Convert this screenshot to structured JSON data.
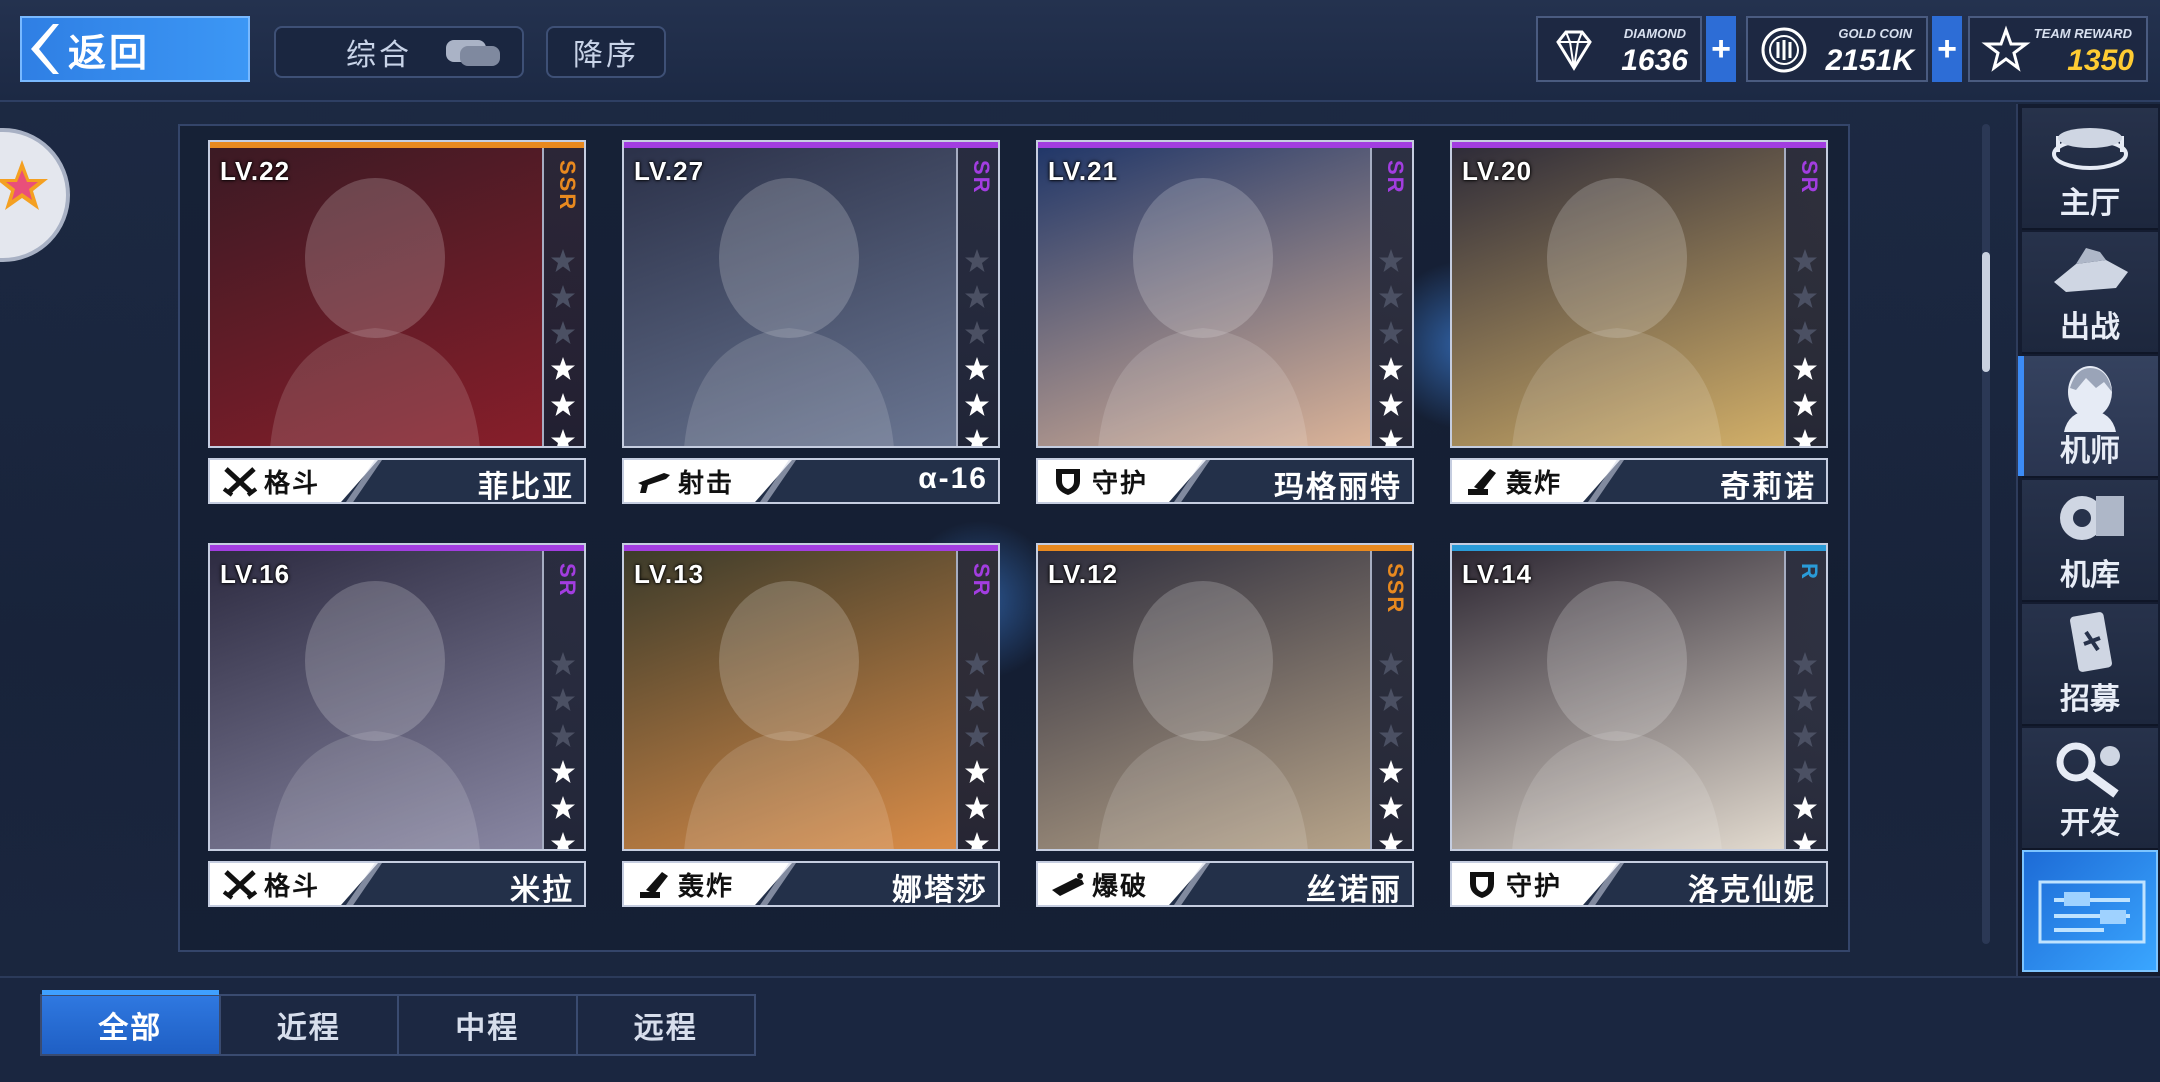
{
  "header": {
    "back_label": "返回",
    "sort_label": "综合",
    "order_label": "降序"
  },
  "resources": {
    "diamond": {
      "name": "DIAMOND",
      "value": "1636",
      "icon": "diamond-icon"
    },
    "gold": {
      "name": "GOLD COIN",
      "value": "2151K",
      "icon": "gold-coin-icon"
    },
    "team": {
      "name": "TEAM REWARD",
      "value": "1350",
      "icon": "team-reward-icon"
    },
    "plus_label": "+"
  },
  "cards": [
    {
      "lv": "LV.22",
      "rarity": "SSR",
      "stars": 3,
      "class": "格斗",
      "class_icon": "fight-icon",
      "name": "菲比亚",
      "color": "#e8891f",
      "bg": [
        "#3a1a24",
        "#8a1e2a"
      ]
    },
    {
      "lv": "LV.27",
      "rarity": "SR",
      "stars": 3,
      "class": "射击",
      "class_icon": "rifle-icon",
      "name": "α-16",
      "color": "#a23de0",
      "bg": [
        "#2a3048",
        "#6c7894"
      ]
    },
    {
      "lv": "LV.21",
      "rarity": "SR",
      "stars": 3,
      "class": "守护",
      "class_icon": "shield-icon",
      "name": "玛格丽特",
      "color": "#a23de0",
      "bg": [
        "#1e3568",
        "#e2b89a"
      ]
    },
    {
      "lv": "LV.20",
      "rarity": "SR",
      "stars": 3,
      "class": "轰炸",
      "class_icon": "mortar-icon",
      "name": "奇莉诺",
      "color": "#a23de0",
      "bg": [
        "#2c2a38",
        "#d8b46a"
      ]
    },
    {
      "lv": "LV.16",
      "rarity": "SR",
      "stars": 3,
      "class": "格斗",
      "class_icon": "fight-icon",
      "name": "米拉",
      "color": "#a23de0",
      "bg": [
        "#2c2a40",
        "#8c8aa6"
      ]
    },
    {
      "lv": "LV.13",
      "rarity": "SR",
      "stars": 3,
      "class": "轰炸",
      "class_icon": "mortar-icon",
      "name": "娜塔莎",
      "color": "#a23de0",
      "bg": [
        "#3a3a2a",
        "#e0904a"
      ]
    },
    {
      "lv": "LV.12",
      "rarity": "SSR",
      "stars": 3,
      "class": "爆破",
      "class_icon": "demolition-icon",
      "name": "丝诺丽",
      "color": "#e8891f",
      "bg": [
        "#2c2c3c",
        "#bca88c"
      ]
    },
    {
      "lv": "LV.14",
      "rarity": "R",
      "stars": 2,
      "class": "守护",
      "class_icon": "shield-icon",
      "name": "洛克仙妮",
      "color": "#2a9bd8",
      "bg": [
        "#2a2430",
        "#e8e0d4"
      ]
    }
  ],
  "nav": [
    {
      "label": "主厅",
      "icon": "lobby-icon"
    },
    {
      "label": "出战",
      "icon": "sortie-icon"
    },
    {
      "label": "机师",
      "icon": "pilot-icon",
      "active": true
    },
    {
      "label": "机库",
      "icon": "hangar-icon"
    },
    {
      "label": "招募",
      "icon": "recruit-icon"
    },
    {
      "label": "开发",
      "icon": "develop-icon"
    }
  ],
  "tabs": [
    {
      "label": "全部",
      "active": true
    },
    {
      "label": "近程"
    },
    {
      "label": "中程"
    },
    {
      "label": "远程"
    }
  ]
}
